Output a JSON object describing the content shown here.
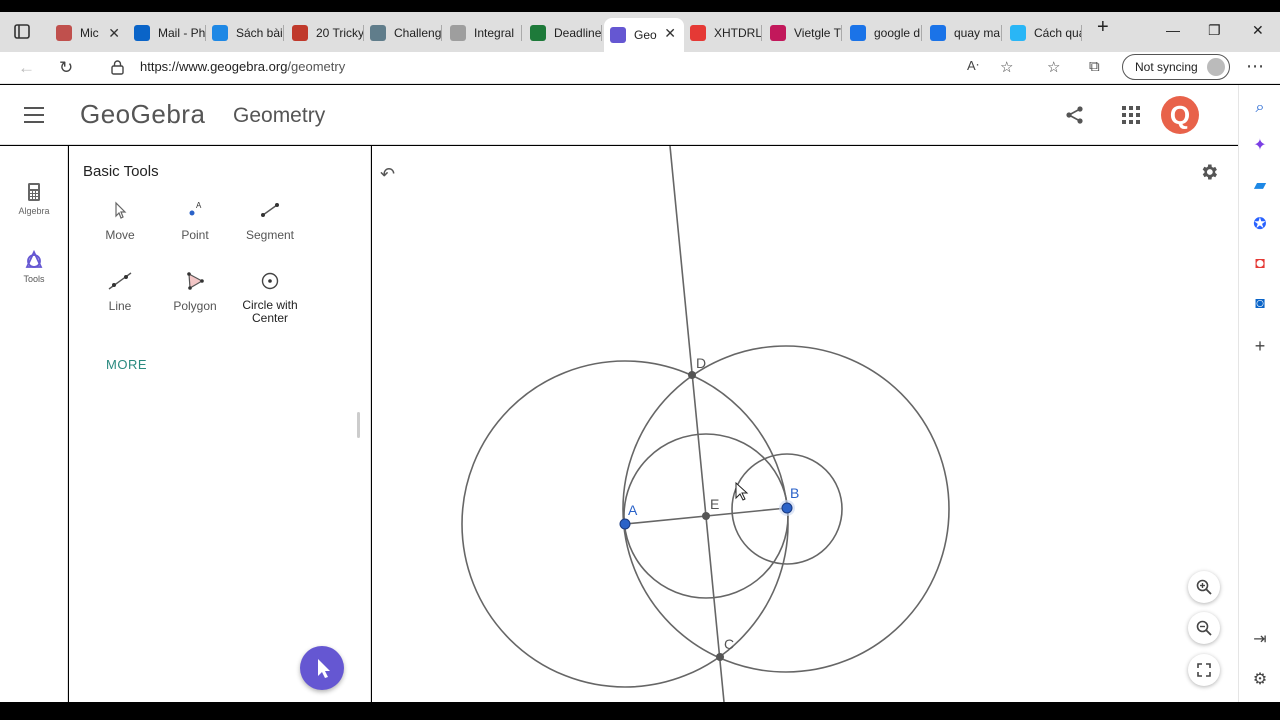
{
  "browser": {
    "tabs": [
      {
        "label": "Mic",
        "color": "#c0504d"
      },
      {
        "label": "Mail - Ph",
        "color": "#0a64c8"
      },
      {
        "label": "Sách bài",
        "color": "#1e88e5"
      },
      {
        "label": "20 Tricky",
        "color": "#c0392b"
      },
      {
        "label": "Challeng",
        "color": "#607d8b"
      },
      {
        "label": "Integral",
        "color": "#9e9e9e"
      },
      {
        "label": "Deadline",
        "color": "#1e7a3a"
      },
      {
        "label": "Geo",
        "color": "#6557d2"
      },
      {
        "label": "XHTDRL",
        "color": "#e53935"
      },
      {
        "label": "Vietgle T",
        "color": "#c2185b"
      },
      {
        "label": "google d",
        "color": "#1a73e8"
      },
      {
        "label": "quay ma",
        "color": "#1a73e8"
      },
      {
        "label": "Cách qua",
        "color": "#29b6f6"
      }
    ],
    "url_host": "https://www.geogebra.org",
    "url_path": "/geometry",
    "sync_label": "Not syncing"
  },
  "app": {
    "brand": "GeoGebra",
    "title": "Geometry"
  },
  "rail": {
    "algebra_label": "Algebra",
    "tools_label": "Tools"
  },
  "tools": {
    "title": "Basic Tools",
    "items": [
      {
        "label": "Move"
      },
      {
        "label": "Point"
      },
      {
        "label": "Segment"
      },
      {
        "label": "Line"
      },
      {
        "label": "Polygon"
      },
      {
        "label": "Circle with Center"
      }
    ],
    "more_label": "MORE"
  },
  "construction": {
    "points": [
      {
        "name": "A",
        "color": "#2a62c8"
      },
      {
        "name": "B",
        "color": "#2a62c8"
      },
      {
        "name": "C",
        "color": "#555555"
      },
      {
        "name": "D",
        "color": "#555555"
      },
      {
        "name": "E",
        "color": "#555555"
      }
    ]
  },
  "colors": {
    "accent": "#6557d2",
    "more": "#2a8a80",
    "avatar": "#e8624a"
  }
}
